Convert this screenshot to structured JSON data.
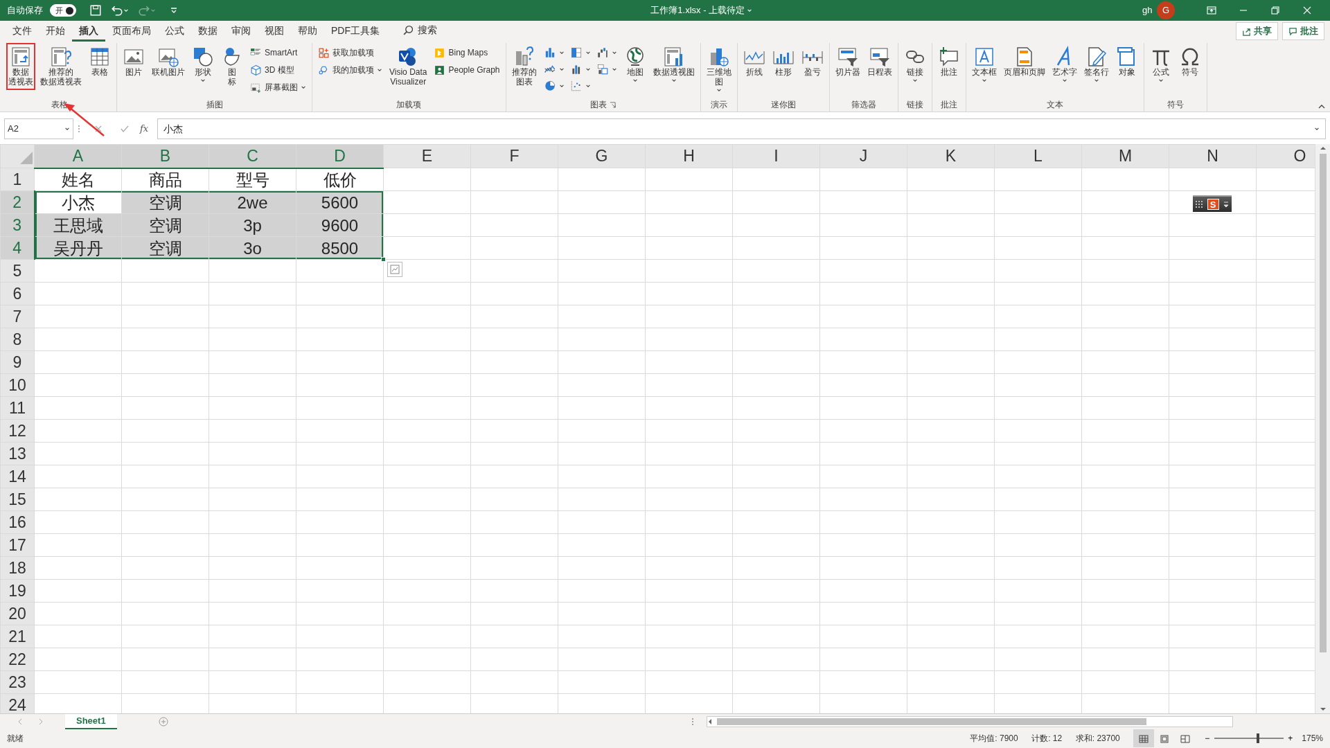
{
  "title_bar": {
    "autosave_label": "自动保存",
    "autosave_toggle": {
      "label": "开",
      "on": true
    },
    "redo_disabled": true,
    "title": "工作簿1.xlsx  -  上载待定",
    "user": "gh",
    "avatar": "G"
  },
  "menu_tabs": [
    {
      "label": "文件",
      "selected": false
    },
    {
      "label": "开始",
      "selected": false
    },
    {
      "label": "插入",
      "selected": true
    },
    {
      "label": "页面布局",
      "selected": false
    },
    {
      "label": "公式",
      "selected": false
    },
    {
      "label": "数据",
      "selected": false
    },
    {
      "label": "审阅",
      "selected": false
    },
    {
      "label": "视图",
      "selected": false
    },
    {
      "label": "帮助",
      "selected": false
    },
    {
      "label": "PDF工具集",
      "selected": false
    }
  ],
  "search": {
    "label": "搜索"
  },
  "share_button": "共享",
  "comments_button": "批注",
  "ribbon": [
    {
      "label": "表格",
      "items": [
        {
          "kind": "large",
          "lines": [
            "数据",
            "透视表"
          ],
          "dropdown": false,
          "highlighted": true
        },
        {
          "kind": "large",
          "lines": [
            "推荐的",
            "数据透视表"
          ],
          "dropdown": false,
          "highlighted": false
        },
        {
          "kind": "large",
          "lines": [
            "表格"
          ],
          "dropdown": false,
          "highlighted": false
        }
      ]
    },
    {
      "label": "插图",
      "items": [
        {
          "kind": "large",
          "lines": [
            "图片"
          ],
          "dropdown": false,
          "highlighted": false
        },
        {
          "kind": "large",
          "lines": [
            "联机图片"
          ],
          "dropdown": false,
          "highlighted": false
        },
        {
          "kind": "large",
          "lines": [
            "形状"
          ],
          "dropdown": true,
          "highlighted": false
        },
        {
          "kind": "large",
          "lines": [
            "图",
            "标"
          ],
          "dropdown": false,
          "highlighted": false
        },
        {
          "kind": "small",
          "lines": [
            "SmartArt"
          ],
          "dropdown": false,
          "highlighted": false
        },
        {
          "kind": "small",
          "lines": [
            "3D 模型"
          ],
          "dropdown": false,
          "highlighted": false
        },
        {
          "kind": "small",
          "lines": [
            "屏幕截图"
          ],
          "dropdown": true,
          "highlighted": false
        }
      ]
    },
    {
      "label": "加载项",
      "items": [
        {
          "kind": "small",
          "lines": [
            "获取加载项"
          ],
          "dropdown": false,
          "highlighted": false
        },
        {
          "kind": "small",
          "lines": [
            "我的加载项"
          ],
          "dropdown": true,
          "highlighted": false
        },
        {
          "kind": "large",
          "lines": [
            "Visio Data",
            "Visualizer"
          ],
          "dropdown": false,
          "highlighted": false
        },
        {
          "kind": "small",
          "lines": [
            "Bing Maps"
          ],
          "dropdown": false,
          "highlighted": false
        },
        {
          "kind": "small",
          "lines": [
            "People Graph"
          ],
          "dropdown": false,
          "highlighted": false
        }
      ]
    },
    {
      "label": "图表",
      "launcher": true,
      "items": [
        {
          "kind": "large",
          "lines": [
            "推荐的",
            "图表"
          ],
          "dropdown": false,
          "highlighted": false
        },
        {
          "kind": "icon",
          "dropdown": true,
          "highlighted": false
        },
        {
          "kind": "icon",
          "dropdown": true,
          "highlighted": false
        },
        {
          "kind": "icon",
          "dropdown": true,
          "highlighted": false
        },
        {
          "kind": "icon",
          "dropdown": true,
          "highlighted": false
        },
        {
          "kind": "icon",
          "dropdown": true,
          "highlighted": false
        },
        {
          "kind": "icon",
          "dropdown": true,
          "highlighted": false
        },
        {
          "kind": "icon",
          "dropdown": true,
          "highlighted": false
        },
        {
          "kind": "icon",
          "dropdown": true,
          "highlighted": false
        },
        {
          "kind": "large",
          "lines": [
            "地图"
          ],
          "dropdown": true,
          "highlighted": false
        },
        {
          "kind": "large",
          "lines": [
            "数据透视图"
          ],
          "dropdown": true,
          "highlighted": false
        }
      ]
    },
    {
      "label": "演示",
      "items": [
        {
          "kind": "large",
          "lines": [
            "三维地",
            "图"
          ],
          "dropdown": true,
          "highlighted": false
        }
      ]
    },
    {
      "label": "迷你图",
      "items": [
        {
          "kind": "large",
          "lines": [
            "折线"
          ],
          "dropdown": false,
          "highlighted": false
        },
        {
          "kind": "large",
          "lines": [
            "柱形"
          ],
          "dropdown": false,
          "highlighted": false
        },
        {
          "kind": "large",
          "lines": [
            "盈亏"
          ],
          "dropdown": false,
          "highlighted": false
        }
      ]
    },
    {
      "label": "筛选器",
      "items": [
        {
          "kind": "large",
          "lines": [
            "切片器"
          ],
          "dropdown": false,
          "highlighted": false
        },
        {
          "kind": "large",
          "lines": [
            "日程表"
          ],
          "dropdown": false,
          "highlighted": false
        }
      ]
    },
    {
      "label": "链接",
      "items": [
        {
          "kind": "large",
          "lines": [
            "链接"
          ],
          "dropdown": true,
          "highlighted": false
        }
      ]
    },
    {
      "label": "批注",
      "items": [
        {
          "kind": "large",
          "lines": [
            "批注"
          ],
          "dropdown": false,
          "highlighted": false
        }
      ]
    },
    {
      "label": "文本",
      "items": [
        {
          "kind": "large",
          "lines": [
            "文本框"
          ],
          "dropdown": true,
          "highlighted": false
        },
        {
          "kind": "large",
          "lines": [
            "页眉和页脚"
          ],
          "dropdown": false,
          "highlighted": false
        },
        {
          "kind": "large",
          "lines": [
            "艺术字"
          ],
          "dropdown": true,
          "highlighted": false
        },
        {
          "kind": "large",
          "lines": [
            "签名行"
          ],
          "dropdown": true,
          "highlighted": false
        },
        {
          "kind": "large",
          "lines": [
            "对象"
          ],
          "dropdown": false,
          "highlighted": false
        }
      ]
    },
    {
      "label": "符号",
      "items": [
        {
          "kind": "large",
          "lines": [
            "公式"
          ],
          "dropdown": true,
          "highlighted": false
        },
        {
          "kind": "large",
          "lines": [
            "符号"
          ],
          "dropdown": false,
          "highlighted": false
        }
      ]
    }
  ],
  "pointer_arrow": true,
  "formula_bar": {
    "name_box": "A2",
    "function_label": "fx",
    "value": "小杰"
  },
  "columns": [
    {
      "label": "A",
      "selected": true
    },
    {
      "label": "B",
      "selected": true
    },
    {
      "label": "C",
      "selected": true
    },
    {
      "label": "D",
      "selected": true
    },
    {
      "label": "E",
      "selected": false
    },
    {
      "label": "F",
      "selected": false
    },
    {
      "label": "G",
      "selected": false
    },
    {
      "label": "H",
      "selected": false
    },
    {
      "label": "I",
      "selected": false
    },
    {
      "label": "J",
      "selected": false
    },
    {
      "label": "K",
      "selected": false
    },
    {
      "label": "L",
      "selected": false
    },
    {
      "label": "M",
      "selected": false
    },
    {
      "label": "N",
      "selected": false
    },
    {
      "label": "O",
      "selected": false
    }
  ],
  "rows": [
    {
      "label": "1",
      "selected": false,
      "cells": [
        {
          "text": "姓名",
          "selected": false,
          "active": false
        },
        {
          "text": "商品",
          "selected": false,
          "active": false
        },
        {
          "text": "型号",
          "selected": false,
          "active": false
        },
        {
          "text": "低价",
          "selected": false,
          "active": false
        }
      ]
    },
    {
      "label": "2",
      "selected": true,
      "cells": [
        {
          "text": "小杰",
          "selected": true,
          "active": true
        },
        {
          "text": "空调",
          "selected": true,
          "active": false
        },
        {
          "text": "2we",
          "selected": true,
          "active": false
        },
        {
          "text": "5600",
          "selected": true,
          "active": false
        }
      ]
    },
    {
      "label": "3",
      "selected": true,
      "cells": [
        {
          "text": "王思域",
          "selected": true,
          "active": false
        },
        {
          "text": "空调",
          "selected": true,
          "active": false
        },
        {
          "text": "3p",
          "selected": true,
          "active": false
        },
        {
          "text": "9600",
          "selected": true,
          "active": false
        }
      ]
    },
    {
      "label": "4",
      "selected": true,
      "cells": [
        {
          "text": "吴丹丹",
          "selected": true,
          "active": false
        },
        {
          "text": "空调",
          "selected": true,
          "active": false
        },
        {
          "text": "3o",
          "selected": true,
          "active": false
        },
        {
          "text": "8500",
          "selected": true,
          "active": false
        }
      ]
    },
    {
      "label": "5",
      "selected": false,
      "cells": []
    },
    {
      "label": "6",
      "selected": false,
      "cells": []
    },
    {
      "label": "7",
      "selected": false,
      "cells": []
    },
    {
      "label": "8",
      "selected": false,
      "cells": []
    },
    {
      "label": "9",
      "selected": false,
      "cells": []
    },
    {
      "label": "10",
      "selected": false,
      "cells": []
    },
    {
      "label": "11",
      "selected": false,
      "cells": []
    },
    {
      "label": "12",
      "selected": false,
      "cells": []
    },
    {
      "label": "13",
      "selected": false,
      "cells": []
    },
    {
      "label": "14",
      "selected": false,
      "cells": []
    },
    {
      "label": "15",
      "selected": false,
      "cells": []
    },
    {
      "label": "16",
      "selected": false,
      "cells": []
    },
    {
      "label": "17",
      "selected": false,
      "cells": []
    },
    {
      "label": "18",
      "selected": false,
      "cells": []
    },
    {
      "label": "19",
      "selected": false,
      "cells": []
    },
    {
      "label": "20",
      "selected": false,
      "cells": []
    },
    {
      "label": "21",
      "selected": false,
      "cells": []
    },
    {
      "label": "22",
      "selected": false,
      "cells": []
    },
    {
      "label": "23",
      "selected": false,
      "cells": []
    },
    {
      "label": "24",
      "selected": false,
      "cells": []
    }
  ],
  "ime_toolbar": {
    "logo": "S"
  },
  "sheet_tabs": [
    {
      "label": "Sheet1",
      "selected": true
    }
  ],
  "status_bar": {
    "state": "就绪",
    "stats": [
      "平均值: 7900",
      "计数: 12",
      "求和: 23700"
    ],
    "view_buttons": [
      {
        "selected": true
      },
      {
        "selected": false
      },
      {
        "selected": false
      }
    ],
    "zoom": {
      "minus": "−",
      "plus": "+",
      "level": 0.63,
      "label": "175%"
    }
  }
}
